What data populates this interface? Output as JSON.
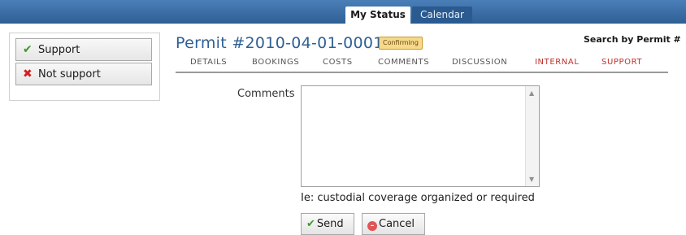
{
  "topnav": {
    "tabs": [
      {
        "label": "My Status",
        "active": true
      },
      {
        "label": "Calendar",
        "active": false
      }
    ]
  },
  "sidebar": {
    "support_label": "Support",
    "not_support_label": "Not support"
  },
  "permit": {
    "title": "Permit #2010-04-01-0001",
    "status_badge": "Confirming",
    "search_label": "Search by Permit #"
  },
  "subnav": {
    "items": [
      "DETAILS",
      "BOOKINGS",
      "COSTS",
      "COMMENTS",
      "DISCUSSION",
      "INTERNAL",
      "SUPPORT"
    ]
  },
  "form": {
    "comments_label": "Comments",
    "comments_value": "",
    "hint": "Ie: custodial coverage organized or required",
    "send_label": "Send",
    "cancel_label": "Cancel"
  },
  "icons": {
    "check": "check-icon",
    "x": "x-icon",
    "cancel": "cancel-icon"
  },
  "colors": {
    "topbar": "#2f5f94",
    "title": "#2f5f94",
    "badge": "#f6d98a",
    "subnav_red": "#c0302a"
  }
}
